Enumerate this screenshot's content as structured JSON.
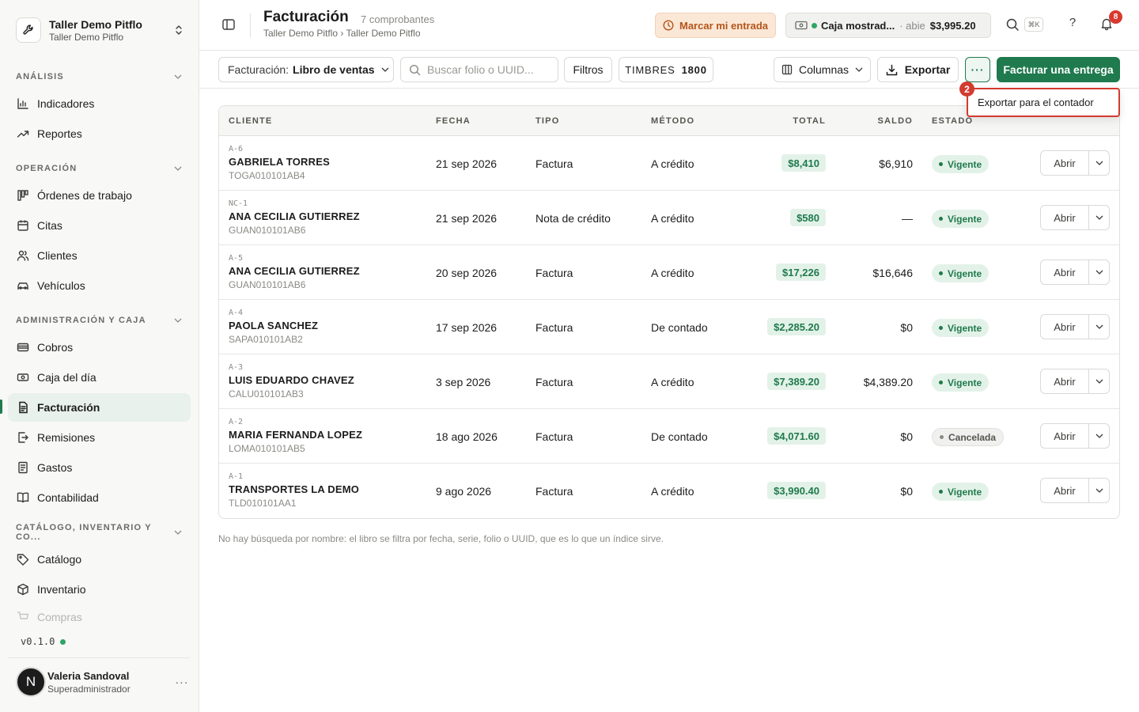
{
  "org": {
    "name": "Taller Demo Pitflo",
    "subtitle": "Taller Demo Pitflo"
  },
  "sidebar": {
    "sections": [
      {
        "title": "ANÁLISIS",
        "items": [
          {
            "label": "Indicadores",
            "icon": "chart-bar-icon"
          },
          {
            "label": "Reportes",
            "icon": "trend-up-icon"
          }
        ]
      },
      {
        "title": "OPERACIÓN",
        "items": [
          {
            "label": "Órdenes de trabajo",
            "icon": "kanban-icon"
          },
          {
            "label": "Citas",
            "icon": "calendar-icon"
          },
          {
            "label": "Clientes",
            "icon": "users-icon"
          },
          {
            "label": "Vehículos",
            "icon": "car-icon"
          }
        ]
      },
      {
        "title": "ADMINISTRACIÓN Y CAJA",
        "items": [
          {
            "label": "Cobros",
            "icon": "card-icon"
          },
          {
            "label": "Caja del día",
            "icon": "cash-icon"
          },
          {
            "label": "Facturación",
            "icon": "invoice-icon",
            "active": true
          },
          {
            "label": "Remisiones",
            "icon": "file-export-icon"
          },
          {
            "label": "Gastos",
            "icon": "receipt-icon"
          },
          {
            "label": "Contabilidad",
            "icon": "book-icon"
          }
        ]
      },
      {
        "title": "CATÁLOGO, INVENTARIO Y CO...",
        "items": [
          {
            "label": "Catálogo",
            "icon": "tag-icon"
          },
          {
            "label": "Inventario",
            "icon": "box-icon"
          },
          {
            "label": "Compras",
            "icon": "cart-icon"
          }
        ]
      }
    ],
    "version": "v0.1.0",
    "user": {
      "initial": "N",
      "name": "Valeria Sandoval",
      "role": "Superadministrador"
    }
  },
  "header": {
    "title": "Facturación",
    "count": "7 comprobantes",
    "breadcrumb": "Taller Demo Pitflo › Taller Demo Pitflo",
    "entry_button": "Marcar mi entrada",
    "cash": {
      "name": "Caja mostrad...",
      "status": "· abie",
      "amount": "$3,995.20"
    },
    "shortcut": "⌘K",
    "help": "?",
    "notifications": "8"
  },
  "toolbar": {
    "book_label": "Facturación:",
    "book_value": "Libro de ventas",
    "search_placeholder": "Buscar folio o UUID...",
    "filters": "Filtros",
    "stamps_label": "TIMBRES",
    "stamps_value": "1800",
    "columns": "Columnas",
    "export": "Exportar",
    "more": "···",
    "primary": "Facturar una entrega"
  },
  "dropdown": {
    "step": "2",
    "item": "Exportar para el contador"
  },
  "table": {
    "headers": {
      "cliente": "CLIENTE",
      "fecha": "FECHA",
      "tipo": "TIPO",
      "metodo": "MÉTODO",
      "total": "TOTAL",
      "saldo": "SALDO",
      "estado": "ESTADO"
    },
    "open_label": "Abrir",
    "rows": [
      {
        "folio": "A-6",
        "name": "GABRIELA TORRES",
        "rfc": "TOGA010101AB4",
        "date": "21 sep 2026",
        "type": "Factura",
        "method": "A crédito",
        "total": "$8,410",
        "saldo": "$6,910",
        "status": "Vigente",
        "status_kind": "vigente"
      },
      {
        "folio": "NC-1",
        "name": "ANA CECILIA GUTIERREZ",
        "rfc": "GUAN010101AB6",
        "date": "21 sep 2026",
        "type": "Nota de crédito",
        "method": "A crédito",
        "total": "$580",
        "saldo": "—",
        "status": "Vigente",
        "status_kind": "vigente"
      },
      {
        "folio": "A-5",
        "name": "ANA CECILIA GUTIERREZ",
        "rfc": "GUAN010101AB6",
        "date": "20 sep 2026",
        "type": "Factura",
        "method": "A crédito",
        "total": "$17,226",
        "saldo": "$16,646",
        "status": "Vigente",
        "status_kind": "vigente"
      },
      {
        "folio": "A-4",
        "name": "PAOLA SANCHEZ",
        "rfc": "SAPA010101AB2",
        "date": "17 sep 2026",
        "type": "Factura",
        "method": "De contado",
        "total": "$2,285.20",
        "saldo": "$0",
        "status": "Vigente",
        "status_kind": "vigente"
      },
      {
        "folio": "A-3",
        "name": "LUIS EDUARDO CHAVEZ",
        "rfc": "CALU010101AB3",
        "date": "3 sep 2026",
        "type": "Factura",
        "method": "A crédito",
        "total": "$7,389.20",
        "saldo": "$4,389.20",
        "status": "Vigente",
        "status_kind": "vigente"
      },
      {
        "folio": "A-2",
        "name": "MARIA FERNANDA LOPEZ",
        "rfc": "LOMA010101AB5",
        "date": "18 ago 2026",
        "type": "Factura",
        "method": "De contado",
        "total": "$4,071.60",
        "saldo": "$0",
        "status": "Cancelada",
        "status_kind": "cancelada"
      },
      {
        "folio": "A-1",
        "name": "TRANSPORTES LA DEMO",
        "rfc": "TLD010101AA1",
        "date": "9 ago 2026",
        "type": "Factura",
        "method": "A crédito",
        "total": "$3,990.40",
        "saldo": "$0",
        "status": "Vigente",
        "status_kind": "vigente"
      }
    ]
  },
  "footnote": "No hay búsqueda por nombre: el libro se filtra por fecha, serie, folio o UUID, que es lo que un índice sirve.",
  "colors": {
    "accent": "#1f7a4d",
    "warning": "#b4551a",
    "danger": "#d23b2f"
  }
}
